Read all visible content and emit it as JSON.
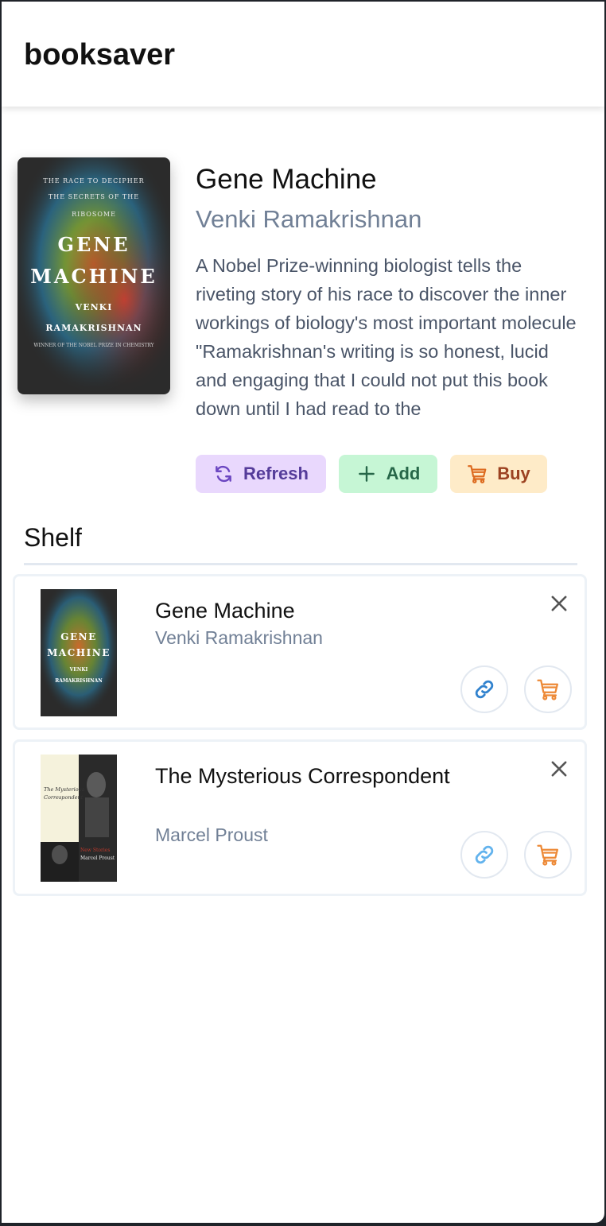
{
  "app": {
    "title": "booksaver"
  },
  "featured": {
    "title": "Gene Machine",
    "author": "Venki Ramakrishnan",
    "description": "A Nobel Prize-winning biologist tells the riveting story of his race to discover the inner workings of biology's most important molecule \"Ramakrishnan's writing is so honest, lucid and engaging that I could not put this book down until I had read to the",
    "cover": {
      "tagline_1": "THE RACE TO DECIPHER",
      "tagline_2": "THE SECRETS OF THE",
      "tagline_3": "RIBOSOME",
      "title_1": "GENE",
      "title_2": "MACHINE",
      "author_1": "VENKI",
      "author_2": "RAMAKRISHNAN",
      "award": "WINNER OF THE NOBEL PRIZE IN CHEMISTRY"
    }
  },
  "actions": {
    "refresh_label": "Refresh",
    "add_label": "Add",
    "buy_label": "Buy"
  },
  "shelf": {
    "heading": "Shelf",
    "items": [
      {
        "title": "Gene Machine",
        "author": "Venki Ramakrishnan",
        "cover": {
          "title_1": "GENE",
          "title_2": "MACHINE",
          "author_1": "VENKI",
          "author_2": "RAMAKRISHNAN"
        }
      },
      {
        "title": "The Mysterious Correspondent",
        "author": "Marcel Proust",
        "cover": {
          "title_1": "The Mysterious",
          "title_2": "Correspondent",
          "sub_1": "New Stories",
          "sub_2": "Marcel Proust"
        }
      }
    ]
  },
  "colors": {
    "refresh_bg": "#e9d8fd",
    "refresh_fg": "#553c9a",
    "add_bg": "#c6f6d5",
    "add_fg": "#276749",
    "buy_bg": "#feebc8",
    "buy_fg": "#dd6b20",
    "link_icon": "#3182ce",
    "cart_icon": "#ed8936",
    "muted_text": "#718096"
  },
  "icons": [
    "refresh-icon",
    "plus-icon",
    "cart-icon",
    "close-icon",
    "link-icon"
  ]
}
